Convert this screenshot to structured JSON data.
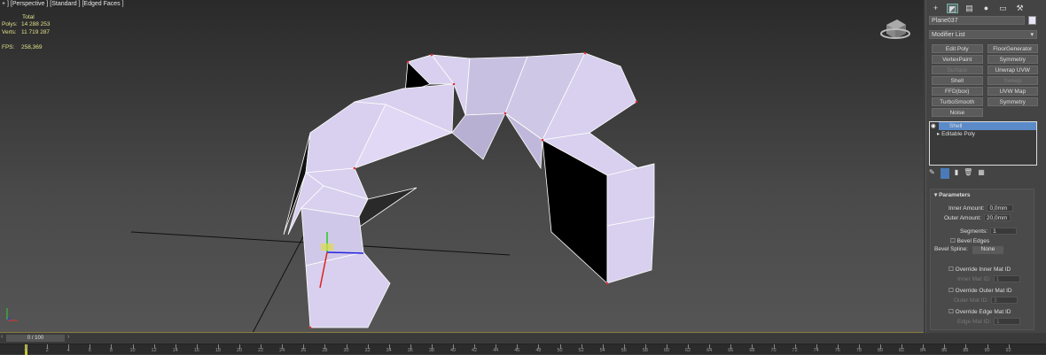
{
  "viewport": {
    "label": "+ ] [Perspective ] [Standard ] [Edged Faces ]",
    "stats": {
      "header": "Total",
      "polys_label": "Polys:",
      "polys": "14 288 253",
      "verts_label": "Verts:",
      "verts": "11 719 287",
      "fps_label": "FPS:",
      "fps": "258,369"
    }
  },
  "panel": {
    "tabs": [
      "create-icon",
      "modify-icon",
      "hierarchy-icon",
      "motion-icon",
      "display-icon",
      "utilities-icon"
    ],
    "object_name": "Plane037",
    "object_color": "#e8e4f8",
    "modifier_list": "Modifier List",
    "modifier_buttons": [
      {
        "label": "Edit Poly",
        "enabled": true
      },
      {
        "label": "FloorGenerator",
        "enabled": true
      },
      {
        "label": "VertexPaint",
        "enabled": true
      },
      {
        "label": "Symmetry",
        "enabled": true
      },
      {
        "label": "Surface",
        "enabled": false
      },
      {
        "label": "Unwrap UVW",
        "enabled": true
      },
      {
        "label": "Shell",
        "enabled": true
      },
      {
        "label": "Sweep",
        "enabled": false
      },
      {
        "label": "FFD(box)",
        "enabled": true
      },
      {
        "label": "UVW Map",
        "enabled": true
      },
      {
        "label": "TurboSmooth",
        "enabled": true
      },
      {
        "label": "Symmetry",
        "enabled": true
      },
      {
        "label": "Noise",
        "enabled": true
      }
    ],
    "stack": [
      "Shell",
      "Editable Poly"
    ],
    "params": {
      "title": "Parameters",
      "inner_label": "Inner Amount:",
      "inner": "0,0mm",
      "outer_label": "Outer Amount:",
      "outer": "20,0mm",
      "segments_label": "Segments:",
      "segments": "1",
      "bevel_edges": "Bevel Edges",
      "bevel_spline_label": "Bevel Spline:",
      "bevel_spline": "None",
      "override_inner": "Override Inner Mat ID",
      "inner_mat_label": "Inner Mat ID:",
      "inner_mat": "1",
      "override_outer": "Override Outer Mat ID",
      "outer_mat_label": "Outer Mat ID:",
      "outer_mat": "3",
      "override_edge": "Override Edge Mat ID",
      "edge_mat_label": "Edge Mat ID:",
      "edge_mat": "1"
    }
  },
  "timeline": {
    "position": "0 / 100",
    "ticks": [
      0,
      2,
      4,
      6,
      8,
      10,
      12,
      14,
      16,
      18,
      20,
      22,
      24,
      26,
      28,
      30,
      32,
      34,
      36,
      38,
      40,
      42,
      44,
      46,
      48,
      50,
      52,
      54,
      56,
      58,
      60,
      62,
      64,
      66,
      68,
      70,
      72,
      74,
      76,
      78,
      80,
      82,
      84,
      86,
      88,
      90,
      92
    ]
  }
}
